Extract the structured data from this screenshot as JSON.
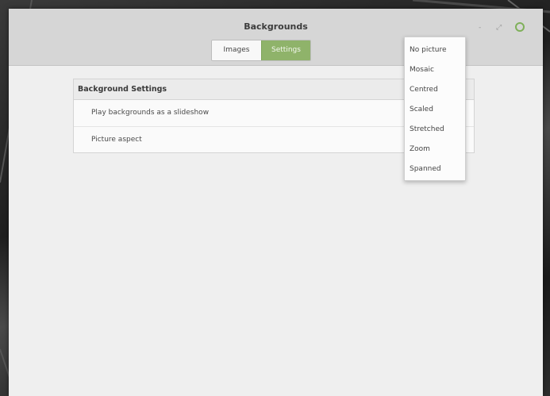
{
  "window": {
    "title": "Backgrounds",
    "controls": {
      "minimize": "-",
      "maximize": "⤢",
      "close": "close"
    }
  },
  "tabs": [
    {
      "label": "Images",
      "active": false
    },
    {
      "label": "Settings",
      "active": true
    }
  ],
  "panel": {
    "header": "Background Settings",
    "rows": [
      {
        "label": "Play backgrounds as a slideshow"
      },
      {
        "label": "Picture aspect"
      }
    ]
  },
  "dropdown": {
    "options": [
      "No picture",
      "Mosaic",
      "Centred",
      "Scaled",
      "Stretched",
      "Zoom",
      "Spanned"
    ]
  },
  "colors": {
    "accent": "#8fb36a",
    "close_button": "#7fb05a"
  }
}
